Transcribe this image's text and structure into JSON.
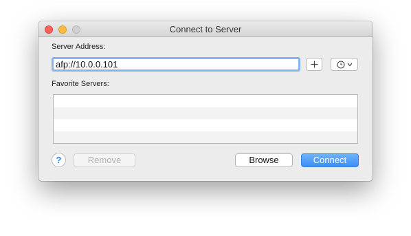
{
  "window": {
    "title": "Connect to Server"
  },
  "server_address": {
    "label": "Server Address:",
    "value": "afp://10.0.0.101"
  },
  "toolbar": {
    "add_icon": "plus-icon",
    "recent_icon": "clock-icon",
    "recent_dropdown_icon": "chevron-down-icon"
  },
  "favorites": {
    "label": "Favorite Servers:",
    "items": []
  },
  "footer": {
    "help_label": "?",
    "remove_label": "Remove",
    "browse_label": "Browse",
    "connect_label": "Connect"
  },
  "colors": {
    "accent": "#3d8ef6",
    "focus_ring": "#85b4f0",
    "close": "#fc605b",
    "minimize": "#fdbc40",
    "zoom_disabled": "#d0d0d0"
  }
}
